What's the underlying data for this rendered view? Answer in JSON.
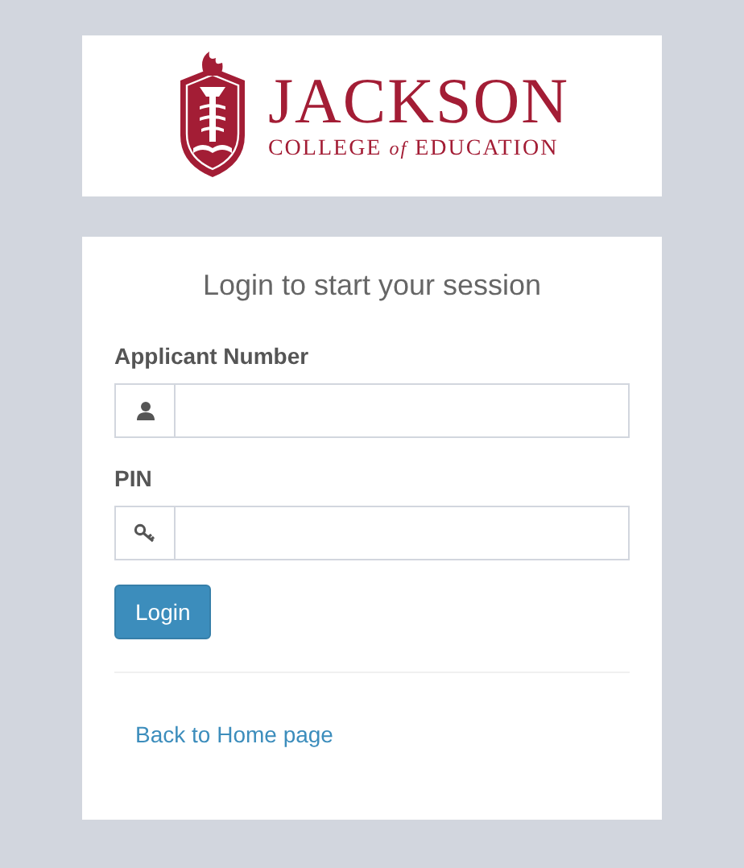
{
  "logo": {
    "name": "JACKSON",
    "subtitle_start": "COLLEGE",
    "subtitle_join": "of",
    "subtitle_end": "EDUCATION"
  },
  "login": {
    "title": "Login to start your session",
    "fields": [
      {
        "label": "Applicant Number",
        "kind": "user"
      },
      {
        "label": "PIN",
        "kind": "key"
      }
    ],
    "button": "Login",
    "link": "Back to Home page"
  }
}
